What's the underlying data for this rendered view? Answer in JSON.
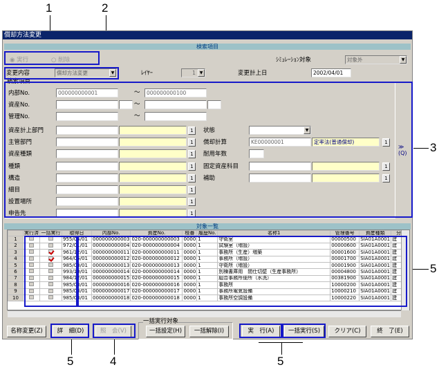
{
  "callouts": {
    "c1": "1",
    "c2": "2",
    "c3": "3",
    "c4": "4",
    "c5a": "5",
    "c5b": "5",
    "c5c": "5",
    "c5d": "5"
  },
  "window": {
    "title": "償却方法変更"
  },
  "search_header": "検索項目",
  "mode": {
    "exec": "実行",
    "delete": "削除"
  },
  "sim": {
    "label": "ｼﾐｭﾚｰｼｮﾝ対象",
    "value": "対象外"
  },
  "change": {
    "label": "変更内容",
    "value": "償却方法変更",
    "layer_label": "ﾚｲﾔｰ",
    "layer_value": "1",
    "date_label": "変更計上日",
    "date_value": "2002/04/01"
  },
  "fields": {
    "group": "検索項目",
    "naibu": "内部No.",
    "naibu_from": "000000000001",
    "naibu_to": "000000000100",
    "shisan": "資産No.",
    "kanri": "管理No.",
    "keijo": "資産計上部門",
    "shukan": "主管部門",
    "shurui": "資産種類",
    "shurui2": "種類",
    "kozo": "構造",
    "hosoku": "細目",
    "basho": "設置場所",
    "shinkoku": "申告先",
    "jotai": "状態",
    "keisan": "償却計算",
    "keisan_code": "KE00000001",
    "keisan_name": "定率法(普通償却)",
    "nensu": "耐用年数",
    "kotei": "固定資産科目",
    "hojo": "補助",
    "tilde": "～",
    "btn": "1",
    "expand": "≫",
    "expand2": "(Q)"
  },
  "list": {
    "header": "対象一覧",
    "columns": [
      "",
      "実行済",
      "一括実行",
      "取得日",
      "内部No.",
      "資産No.",
      "枝番",
      "履歴No.",
      "名称1",
      "管理番号",
      "資産種類",
      "分"
    ],
    "rows": [
      [
        "1",
        "",
        "",
        "955/05/01",
        "000000000003",
        "020-000000000003",
        "0000",
        "1",
        "守衛室",
        "00000500",
        "SIA01A0001",
        "建"
      ],
      [
        "2",
        "",
        "",
        "972/01/01",
        "000000000004",
        "020-000000000004",
        "0000",
        "1",
        "試験室（増設）",
        "00000600",
        "SIA01A0001",
        "建"
      ],
      [
        "3",
        "",
        "on",
        "961/12/01",
        "000000000011",
        "020-000000000011",
        "0000",
        "1",
        "事務所（生産）増築",
        "00001600",
        "SIA01A0001",
        "建"
      ],
      [
        "4",
        "",
        "on",
        "964/05/01",
        "000000000012",
        "020-000000000012",
        "0000",
        "1",
        "事務所（増設）",
        "00001700",
        "SIA01A0001",
        "建"
      ],
      [
        "5",
        "",
        "",
        "985/08/01",
        "000000000013",
        "020-000000000013",
        "0000",
        "1",
        "守衛所（増設）",
        "00001900",
        "SIA01A0001",
        "建"
      ],
      [
        "6",
        "",
        "",
        "993/10/01",
        "000000000014",
        "020-000000000014",
        "0000",
        "1",
        "別棟書庫用　間仕切壁（生産事務所）",
        "00004800",
        "SIA01A0001",
        "建"
      ],
      [
        "7",
        "",
        "",
        "984/12/01",
        "000000000015",
        "020-000000000015",
        "0000",
        "1",
        "組合事務所便所（水洗）",
        "00381900",
        "SIA01A0001",
        "建"
      ],
      [
        "8",
        "",
        "",
        "985/03/01",
        "000000000016",
        "020-000000000016",
        "0000",
        "1",
        "事務所",
        "10000200",
        "SIA01A0001",
        "建"
      ],
      [
        "9",
        "",
        "",
        "985/03/01",
        "000000000017",
        "020-000000000017",
        "0000",
        "1",
        "事務所電気設備",
        "10000210",
        "SIA01A0001",
        "建"
      ],
      [
        "10",
        "",
        "",
        "985/03/01",
        "000000000018",
        "020-000000000018",
        "0000",
        "1",
        "事務所空調設備",
        "10000220",
        "SIA01A0001",
        "建"
      ]
    ]
  },
  "buttons": {
    "rename": "名称変更(Z)",
    "detail": "詳　細(D)",
    "ref": "照　会(V)",
    "bulk_group": "一括実行対象",
    "bulk_set": "一括設定(H)",
    "bulk_clear": "一括解除(I)",
    "exec": "実　行(A)",
    "bulk_exec": "一括実行(S)",
    "clear": "クリア(C)",
    "end": "終　了(E)"
  }
}
